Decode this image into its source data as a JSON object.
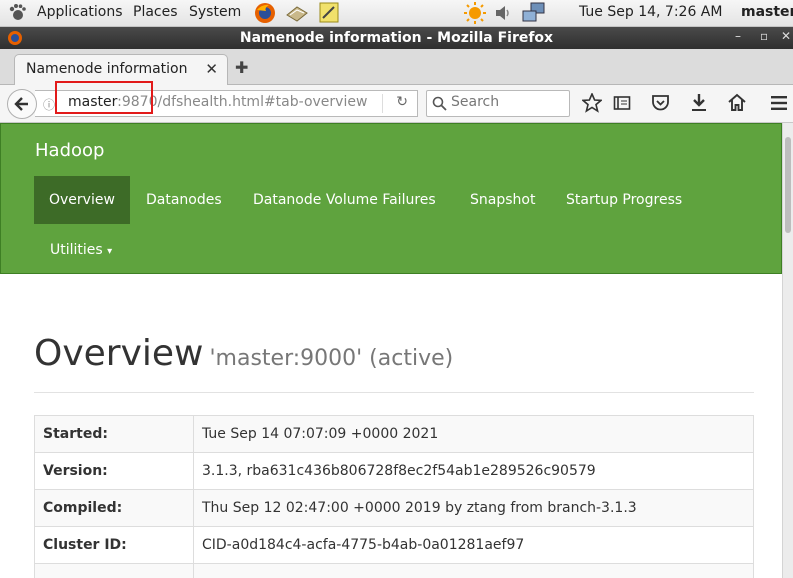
{
  "panel": {
    "applications": "Applications",
    "places": "Places",
    "system": "System",
    "clock": "Tue Sep 14,  7:26 AM",
    "user": "master"
  },
  "window": {
    "title": "Namenode information - Mozilla Firefox"
  },
  "tab": {
    "label": "Namenode information"
  },
  "urlbar": {
    "host": "master",
    "rest": ":9870/dfshealth.html#tab-overview"
  },
  "search": {
    "placeholder": "Search"
  },
  "page": {
    "brand": "Hadoop",
    "nav": [
      "Overview",
      "Datanodes",
      "Datanode Volume Failures",
      "Snapshot",
      "Startup Progress",
      "Utilities"
    ],
    "overview_title": "Overview",
    "overview_subtitle": "'master:9000' (active)",
    "rows": [
      {
        "key": "Started:",
        "value": "Tue Sep 14 07:07:09 +0000 2021"
      },
      {
        "key": "Version:",
        "value": "3.1.3, rba631c436b806728f8ec2f54ab1e289526c90579"
      },
      {
        "key": "Compiled:",
        "value": "Thu Sep 12 02:47:00 +0000 2019 by ztang from branch-3.1.3"
      },
      {
        "key": "Cluster ID:",
        "value": "CID-a0d184c4-acfa-4775-b4ab-0a01281aef97"
      }
    ]
  },
  "colors": {
    "hadoop_green": "#5fa33e",
    "active_nav": "#3d6b27",
    "highlight_box": "#e21a1a"
  },
  "icons": [
    "gnome-foot-icon",
    "firefox-icon",
    "file-manager-icon",
    "text-editor-icon",
    "weather-icon",
    "volume-icon",
    "network-icon",
    "back-arrow-icon",
    "info-icon",
    "reload-icon",
    "search-icon",
    "bookmark-star-icon",
    "reading-list-icon",
    "pocket-icon",
    "download-icon",
    "home-icon",
    "hamburger-menu-icon"
  ]
}
